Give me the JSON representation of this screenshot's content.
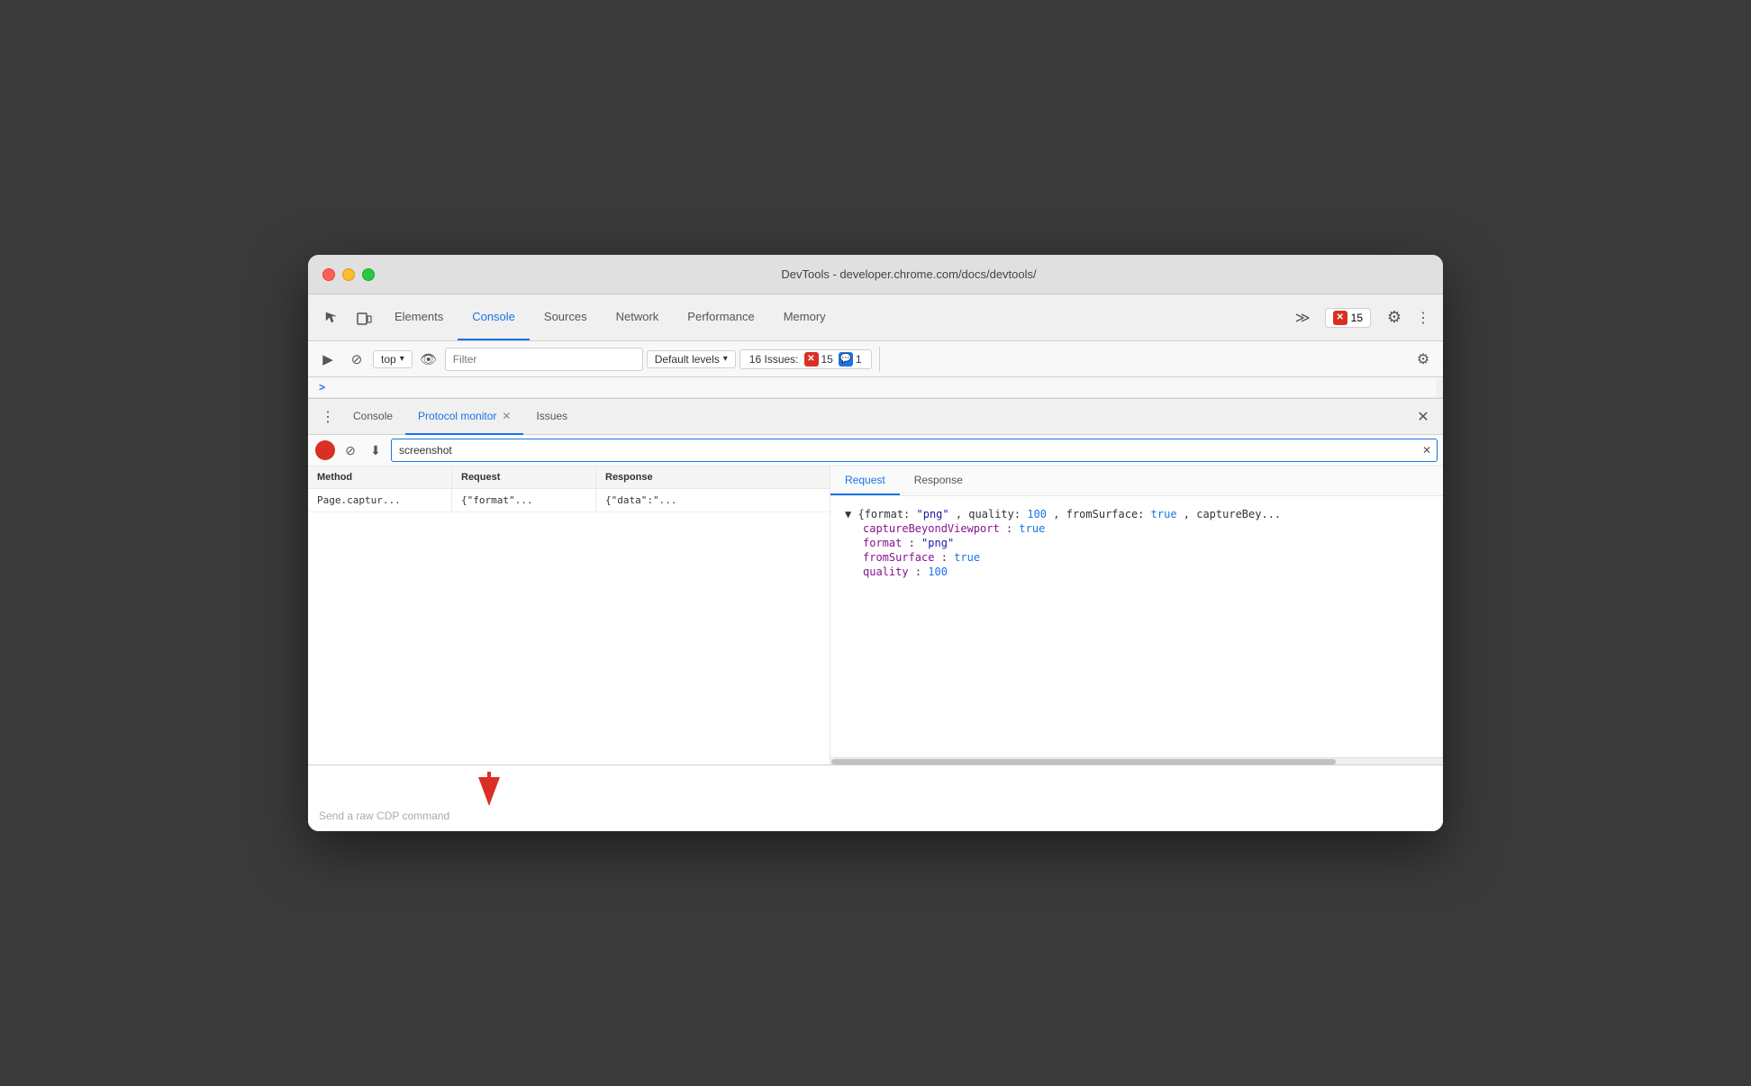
{
  "window": {
    "title": "DevTools - developer.chrome.com/docs/devtools/"
  },
  "tabs_bar": {
    "inspect_icon": "⬚",
    "device_icon": "⧉",
    "tabs": [
      {
        "label": "Elements",
        "active": false
      },
      {
        "label": "Console",
        "active": true
      },
      {
        "label": "Sources",
        "active": false
      },
      {
        "label": "Network",
        "active": false
      },
      {
        "label": "Performance",
        "active": false
      },
      {
        "label": "Memory",
        "active": false
      }
    ],
    "more_tabs": "≫",
    "error_count": "15",
    "gear_label": "⚙",
    "more_label": "⋮"
  },
  "console_toolbar": {
    "run_icon": "▶",
    "block_icon": "⊘",
    "top_label": "top",
    "eye_icon": "👁",
    "filter_placeholder": "Filter",
    "default_levels_label": "Default levels",
    "issues_label": "16 Issues:",
    "error_count": "15",
    "info_count": "1",
    "gear_icon": "⚙"
  },
  "console_prompt": {
    "chevron": ">"
  },
  "drawer": {
    "more_icon": "⋮",
    "tabs": [
      {
        "label": "Console",
        "active": false,
        "closeable": false
      },
      {
        "label": "Protocol monitor",
        "active": true,
        "closeable": true
      },
      {
        "label": "Issues",
        "active": false,
        "closeable": false
      }
    ],
    "close_icon": "✕"
  },
  "protocol_monitor": {
    "record_label": "●",
    "clear_label": "⊘",
    "save_label": "⬇",
    "search_value": "screenshot",
    "search_clear": "✕",
    "columns": {
      "method": "Method",
      "request": "Request",
      "response": "Response"
    },
    "rows": [
      {
        "method": "Page.captur...",
        "request": "{\"format\"...",
        "response": "{\"data\":\"..."
      }
    ],
    "right_tabs": [
      {
        "label": "Request",
        "active": true
      },
      {
        "label": "Response",
        "active": false
      }
    ],
    "right_content": {
      "summary": "▼ {format: \"png\", quality: 100, fromSurface: true, captureBey...",
      "lines": [
        {
          "key": "captureBeyondViewport",
          "value": "true",
          "type": "bool"
        },
        {
          "key": "format",
          "value": "\"png\"",
          "type": "string"
        },
        {
          "key": "fromSurface",
          "value": "true",
          "type": "bool"
        },
        {
          "key": "quality",
          "value": "100",
          "type": "number"
        }
      ]
    },
    "bottom_placeholder": "Send a raw CDP command"
  }
}
